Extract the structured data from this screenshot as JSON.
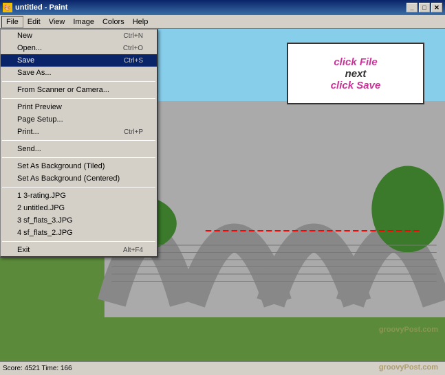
{
  "titlebar": {
    "title": "untitled - Paint",
    "icon": "🎨"
  },
  "menubar": {
    "items": [
      {
        "label": "File",
        "active": true
      },
      {
        "label": "Edit"
      },
      {
        "label": "View"
      },
      {
        "label": "Image"
      },
      {
        "label": "Colors"
      },
      {
        "label": "Help"
      }
    ]
  },
  "dropdown": {
    "items": [
      {
        "label": "New",
        "shortcut": "Ctrl+N",
        "type": "item"
      },
      {
        "label": "Open...",
        "shortcut": "Ctrl+O",
        "type": "item"
      },
      {
        "label": "Save",
        "shortcut": "Ctrl+S",
        "type": "item",
        "selected": true
      },
      {
        "label": "Save As...",
        "shortcut": "",
        "type": "item"
      },
      {
        "type": "separator"
      },
      {
        "label": "From Scanner or Camera...",
        "shortcut": "",
        "type": "item"
      },
      {
        "type": "separator"
      },
      {
        "label": "Print Preview",
        "shortcut": "",
        "type": "item"
      },
      {
        "label": "Page Setup...",
        "shortcut": "",
        "type": "item"
      },
      {
        "label": "Print...",
        "shortcut": "Ctrl+P",
        "type": "item"
      },
      {
        "type": "separator"
      },
      {
        "label": "Send...",
        "shortcut": "",
        "type": "item"
      },
      {
        "type": "separator"
      },
      {
        "label": "Set As Background (Tiled)",
        "shortcut": "",
        "type": "item"
      },
      {
        "label": "Set As Background (Centered)",
        "shortcut": "",
        "type": "item"
      },
      {
        "type": "separator"
      },
      {
        "label": "1 3-rating.JPG",
        "shortcut": "",
        "type": "item"
      },
      {
        "label": "2 untitled.JPG",
        "shortcut": "",
        "type": "item"
      },
      {
        "label": "3 sf_flats_3.JPG",
        "shortcut": "",
        "type": "item"
      },
      {
        "label": "4 sf_flats_2.JPG",
        "shortcut": "",
        "type": "item"
      },
      {
        "type": "separator"
      },
      {
        "label": "Exit",
        "shortcut": "Alt+F4",
        "type": "item"
      }
    ]
  },
  "instruction": {
    "line1": "click File",
    "line2": "next",
    "line3": "click Save"
  },
  "status": {
    "score": "Score: 4521 Time: 166"
  },
  "watermark": {
    "text": "groovyPost.com"
  }
}
